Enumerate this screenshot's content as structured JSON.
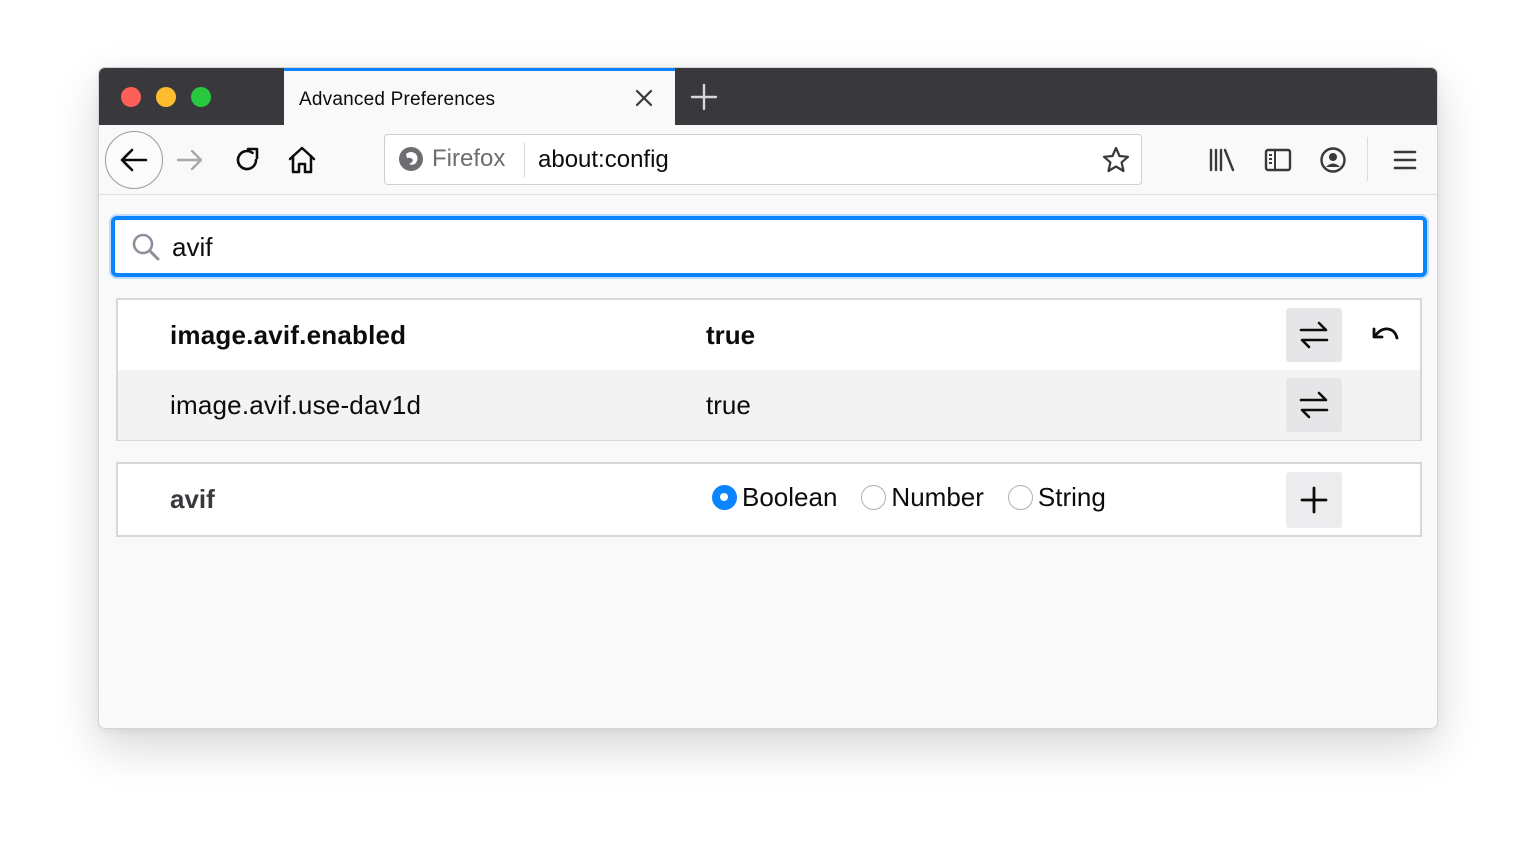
{
  "window": {
    "tab": {
      "title": "Advanced Preferences"
    },
    "urlbar": {
      "identity_label": "Firefox",
      "url": "about:config"
    }
  },
  "search": {
    "value": "avif"
  },
  "preferences": [
    {
      "name": "image.avif.enabled",
      "value": "true",
      "modified": true
    },
    {
      "name": "image.avif.use-dav1d",
      "value": "true",
      "modified": false
    }
  ],
  "add_pref": {
    "name": "avif",
    "types": [
      "Boolean",
      "Number",
      "String"
    ],
    "selected_type": "Boolean"
  },
  "colors": {
    "accent": "#0a84ff",
    "titlebar": "#38383d",
    "traffic_close": "#fe5f57",
    "traffic_min": "#febc2e",
    "traffic_max": "#28c840"
  }
}
